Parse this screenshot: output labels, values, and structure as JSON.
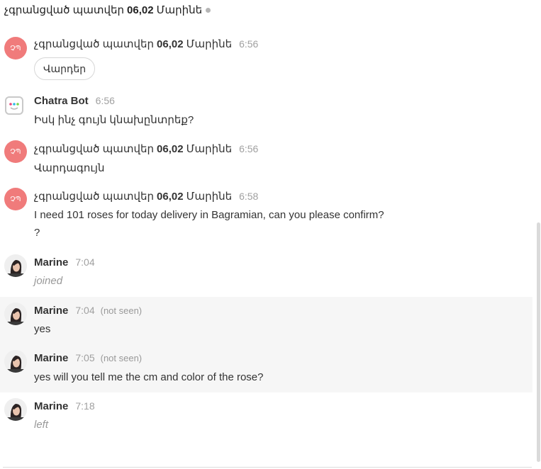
{
  "header": {
    "title_part1": "չգրանցված պատվեր",
    "title_part2": "06,02",
    "title_part3": "Մարինե"
  },
  "messages": [
    {
      "avatar_text": "ՉՊ",
      "name1": "չգրանցված պատվեր",
      "name2": "06,02",
      "name3": "Մարինե",
      "time": "6:56",
      "button": "Վարդեր"
    },
    {
      "name": "Chatra Bot",
      "time": "6:56",
      "text": "Իսկ ինչ գույն կնախընտրեք?"
    },
    {
      "avatar_text": "ՉՊ",
      "name1": "չգրանցված պատվեր",
      "name2": "06,02",
      "name3": "Մարինե",
      "time": "6:56",
      "text": "Վարդագույն"
    },
    {
      "avatar_text": "ՉՊ",
      "name1": "չգրանցված պատվեր",
      "name2": "06,02",
      "name3": "Մարինե",
      "time": "6:58",
      "text": "I need 101 roses for today delivery in Bagramian, can you please confirm?",
      "text2": "?"
    },
    {
      "name": "Marine",
      "time": "7:04",
      "text": "joined"
    },
    {
      "name": "Marine",
      "time": "7:04",
      "seen": "(not seen)",
      "text": "yes"
    },
    {
      "name": "Marine",
      "time": "7:05",
      "seen": "(not seen)",
      "text": "yes will you tell me the cm and color of the rose?"
    },
    {
      "name": "Marine",
      "time": "7:18",
      "text": "left"
    }
  ],
  "colors": {
    "visitor_avatar": "#f07b7b",
    "highlight_row": "#f6f6f6",
    "time_text": "#a0a0a0"
  },
  "icons": {
    "bot_avatar": "chatra-bot-icon",
    "agent_avatar": "marine-photo-avatar",
    "status": "online-status-dot"
  }
}
